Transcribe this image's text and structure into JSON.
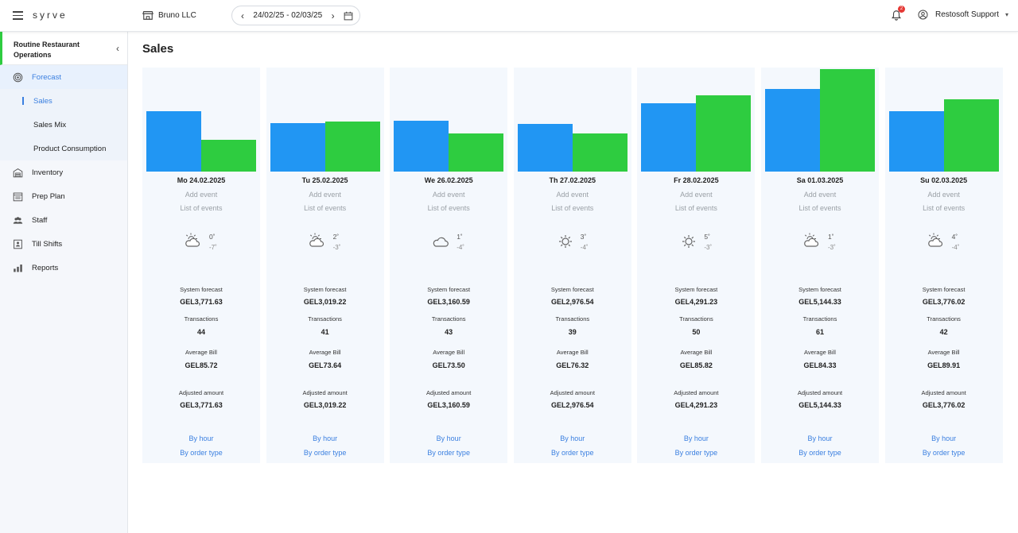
{
  "app": {
    "logo": "syrve"
  },
  "header": {
    "organization": "Bruno LLC",
    "date_range": "24/02/25 - 02/03/25",
    "prev_arrow": "‹",
    "next_arrow": "›",
    "notification_count": "2",
    "user_name": "Restosoft Support"
  },
  "sidebar": {
    "section_title": "Routine Restaurant Operations",
    "collapse_glyph": "‹",
    "items": [
      {
        "label": "Forecast",
        "icon": "target-icon",
        "active": true
      },
      {
        "label": "Inventory",
        "icon": "warehouse-icon"
      },
      {
        "label": "Prep Plan",
        "icon": "calendar-list-icon"
      },
      {
        "label": "Staff",
        "icon": "people-icon"
      },
      {
        "label": "Till Shifts",
        "icon": "cash-register-icon"
      },
      {
        "label": "Reports",
        "icon": "bar-chart-icon"
      }
    ],
    "sub_items": [
      {
        "label": "Sales",
        "active": true
      },
      {
        "label": "Sales Mix"
      },
      {
        "label": "Product Consumption"
      }
    ]
  },
  "page": {
    "title": "Sales",
    "labels": {
      "add_event": "Add event",
      "list_of_events": "List of events",
      "system_forecast": "System forecast",
      "transactions": "Transactions",
      "average_bill": "Average Bill",
      "adjusted_amount": "Adjusted amount",
      "by_hour": "By hour",
      "by_order_type": "By order type"
    }
  },
  "days": [
    {
      "date": "Mo 24.02.2025",
      "weather": "partly-cloudy-icon",
      "temp_high": "0˚",
      "temp_low": "-7˚",
      "system_forecast": "GEL3,771.63",
      "transactions": "44",
      "average_bill": "GEL85.72",
      "adjusted_amount": "GEL3,771.63"
    },
    {
      "date": "Tu 25.02.2025",
      "weather": "partly-cloudy-icon",
      "temp_high": "2˚",
      "temp_low": "-3˚",
      "system_forecast": "GEL3,019.22",
      "transactions": "41",
      "average_bill": "GEL73.64",
      "adjusted_amount": "GEL3,019.22"
    },
    {
      "date": "We 26.02.2025",
      "weather": "cloud-icon",
      "temp_high": "1˚",
      "temp_low": "-4˚",
      "system_forecast": "GEL3,160.59",
      "transactions": "43",
      "average_bill": "GEL73.50",
      "adjusted_amount": "GEL3,160.59"
    },
    {
      "date": "Th 27.02.2025",
      "weather": "sun-icon",
      "temp_high": "3˚",
      "temp_low": "-4˚",
      "system_forecast": "GEL2,976.54",
      "transactions": "39",
      "average_bill": "GEL76.32",
      "adjusted_amount": "GEL2,976.54"
    },
    {
      "date": "Fr 28.02.2025",
      "weather": "sun-icon",
      "temp_high": "5˚",
      "temp_low": "-3˚",
      "system_forecast": "GEL4,291.23",
      "transactions": "50",
      "average_bill": "GEL85.82",
      "adjusted_amount": "GEL4,291.23"
    },
    {
      "date": "Sa 01.03.2025",
      "weather": "partly-cloudy-icon",
      "temp_high": "1˚",
      "temp_low": "-3˚",
      "system_forecast": "GEL5,144.33",
      "transactions": "61",
      "average_bill": "GEL84.33",
      "adjusted_amount": "GEL5,144.33"
    },
    {
      "date": "Su 02.03.2025",
      "weather": "partly-cloudy-icon",
      "temp_high": "4˚",
      "temp_low": "-4˚",
      "system_forecast": "GEL3,776.02",
      "transactions": "42",
      "average_bill": "GEL89.91",
      "adjusted_amount": "GEL3,776.02"
    }
  ],
  "chart_data": {
    "type": "bar",
    "categories": [
      "Mo 24.02.2025",
      "Tu 25.02.2025",
      "We 26.02.2025",
      "Th 27.02.2025",
      "Fr 28.02.2025",
      "Sa 01.03.2025",
      "Su 02.03.2025"
    ],
    "series": [
      {
        "color": "#2196f3",
        "values": [
          3771.63,
          3019.22,
          3160.59,
          2976.54,
          4291.23,
          5144.33,
          3776.02
        ]
      },
      {
        "color": "#2ecc40",
        "values": [
          1990,
          3150,
          2400,
          2360,
          4750,
          6380,
          4520
        ]
      }
    ],
    "ylim": [
      0,
      6500
    ]
  },
  "colors": {
    "accent": "#3a7fe0",
    "system_bar": "#2196f3",
    "adjusted_bar": "#2ecc40",
    "active_marker": "#2ecc40"
  }
}
